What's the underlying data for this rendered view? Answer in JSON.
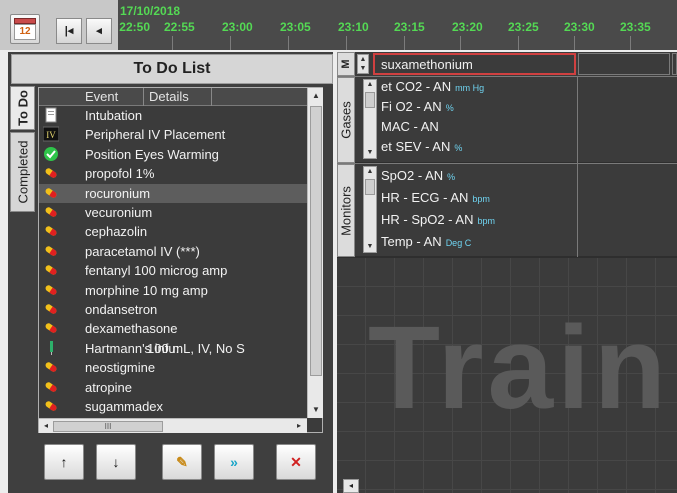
{
  "timeline": {
    "date": "17/10/2018",
    "times": [
      "22:50",
      "22:55",
      "23:00",
      "23:05",
      "23:10",
      "23:15",
      "23:20",
      "23:25",
      "23:30",
      "23:35"
    ],
    "text_color": "#54d954"
  },
  "toolbar": {
    "calendar_day": "12",
    "first_label": "K",
    "prev_label": "<"
  },
  "todo": {
    "title": "To Do List",
    "tabs": [
      "To Do",
      "Completed"
    ],
    "columns": [
      "Event",
      "Details"
    ],
    "items": [
      {
        "event": "Intubation",
        "details": "",
        "icon": "document-icon"
      },
      {
        "event": "Peripheral IV Placement",
        "details": "",
        "icon": "iv-icon"
      },
      {
        "event": "Position Eyes Warming",
        "details": "",
        "icon": "check-icon"
      },
      {
        "event": "propofol 1%",
        "details": "",
        "icon": "pill-icon"
      },
      {
        "event": "rocuronium",
        "details": "",
        "icon": "pill-icon",
        "selected": true
      },
      {
        "event": "vecuronium",
        "details": "",
        "icon": "pill-icon"
      },
      {
        "event": "cephazolin",
        "details": "",
        "icon": "pill-icon"
      },
      {
        "event": "paracetamol IV (***)",
        "details": "",
        "icon": "pill-icon"
      },
      {
        "event": "fentanyl 100 microg amp",
        "details": "",
        "icon": "pill-icon"
      },
      {
        "event": "morphine 10 mg amp",
        "details": "",
        "icon": "pill-icon"
      },
      {
        "event": "ondansetron",
        "details": "",
        "icon": "pill-icon"
      },
      {
        "event": "dexamethasone",
        "details": "",
        "icon": "pill-icon"
      },
      {
        "event": "Hartmann's infu:",
        "details": "100 mL, IV, No S",
        "icon": "drip-icon"
      },
      {
        "event": "neostigmine",
        "details": "",
        "icon": "pill-icon"
      },
      {
        "event": "atropine",
        "details": "",
        "icon": "pill-icon"
      },
      {
        "event": "sugammadex",
        "details": "",
        "icon": "pill-icon"
      }
    ],
    "scroll_thumb_label": "III",
    "buttons": [
      "↑",
      "↓",
      "✎",
      "»",
      "✕"
    ]
  },
  "medication_row": {
    "label": "M",
    "current": "suxamethonium"
  },
  "gases": {
    "label": "Gases",
    "params": [
      {
        "name": "et CO2 - AN",
        "unit": "mm Hg"
      },
      {
        "name": "Fi O2 - AN",
        "unit": "%"
      },
      {
        "name": "MAC - AN",
        "unit": ""
      },
      {
        "name": "et SEV - AN",
        "unit": "%"
      }
    ]
  },
  "monitors": {
    "label": "Monitors",
    "params": [
      {
        "name": "SpO2 - AN",
        "unit": "%"
      },
      {
        "name": "HR - ECG - AN",
        "unit": "bpm"
      },
      {
        "name": "HR - SpO2 - AN",
        "unit": "bpm"
      },
      {
        "name": "Temp - AN",
        "unit": "Deg C"
      }
    ]
  },
  "watermark": "Train",
  "colors": {
    "panel_bg": "#3b3b3b",
    "selection_border": "#d04040",
    "unit_color": "#6fd3f0"
  }
}
